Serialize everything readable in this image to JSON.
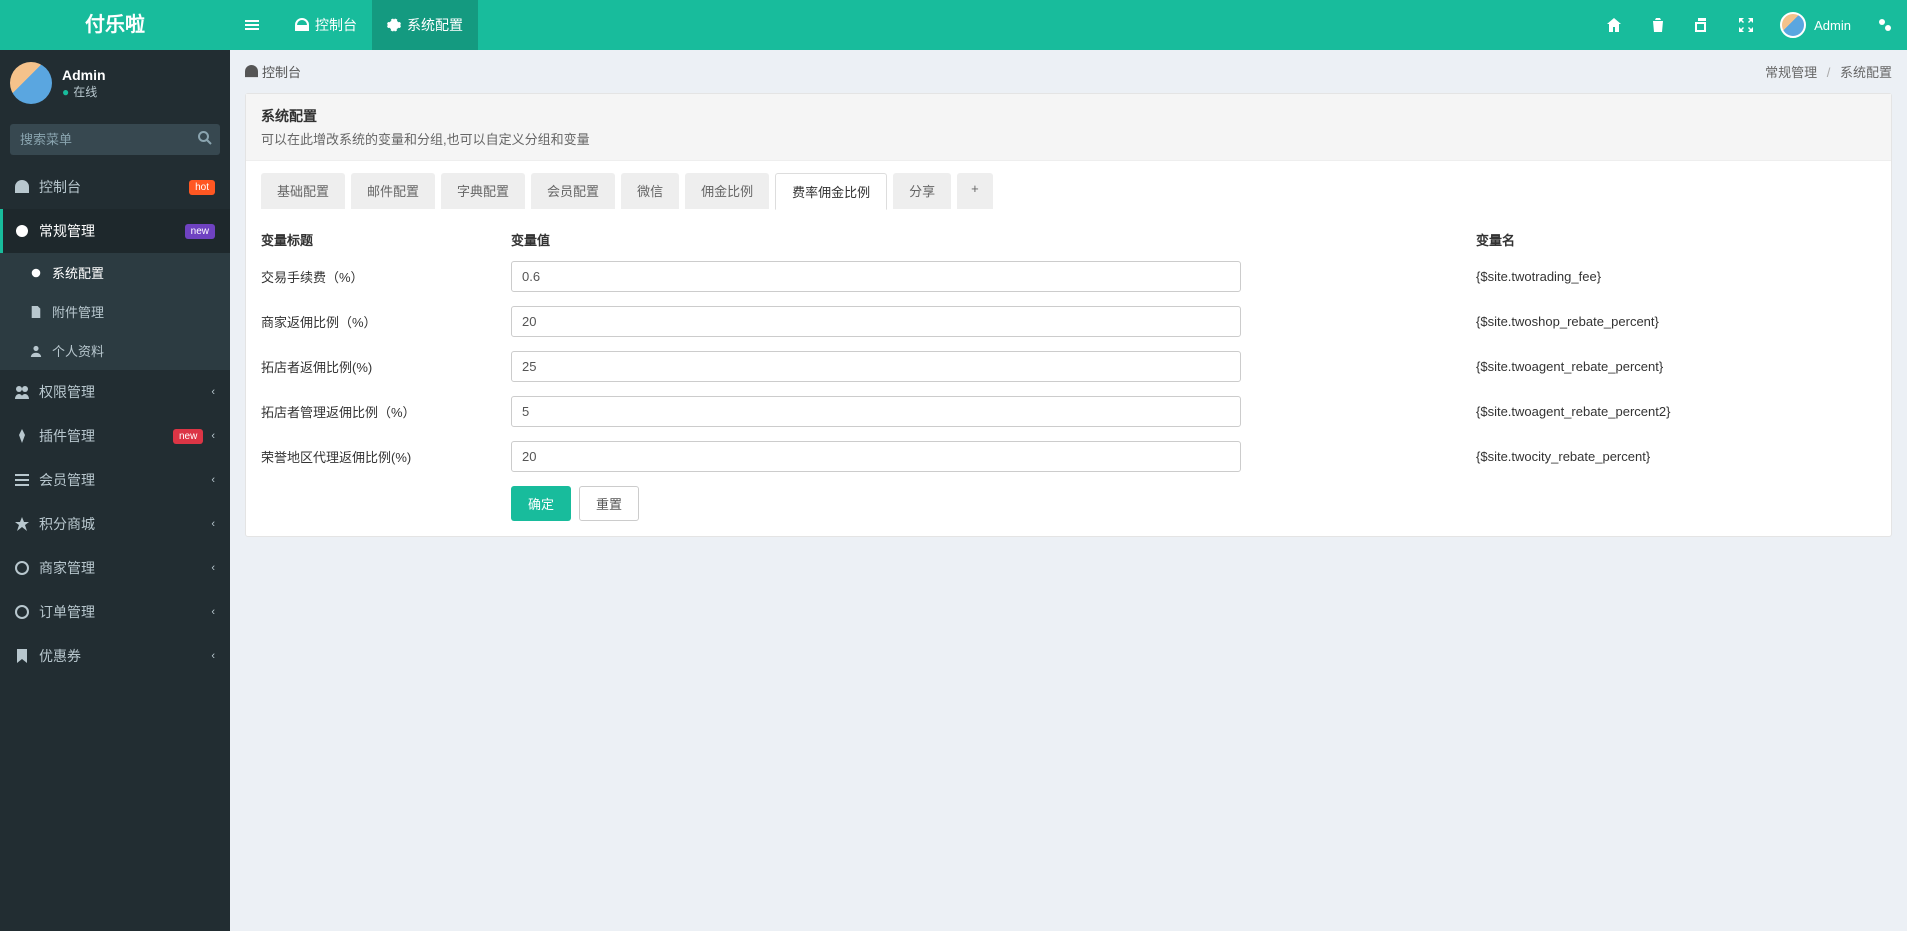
{
  "logo": "付乐啦",
  "topnav": {
    "toggle": "≡",
    "console": "控制台",
    "sysconfig": "系统配置",
    "user": "Admin"
  },
  "user_panel": {
    "name": "Admin",
    "status": "在线"
  },
  "search_placeholder": "搜索菜单",
  "menu": {
    "console": "控制台",
    "general": "常规管理",
    "sysconfig": "系统配置",
    "attach": "附件管理",
    "profile": "个人资料",
    "auth": "权限管理",
    "plugin": "插件管理",
    "member": "会员管理",
    "mall": "积分商城",
    "shop": "商家管理",
    "order": "订单管理",
    "coupon": "优惠券",
    "badge_hot": "hot",
    "badge_new": "new",
    "badge_new2": "new"
  },
  "crumb": {
    "home": "控制台",
    "path1": "常规管理",
    "path2": "系统配置"
  },
  "box": {
    "title": "系统配置",
    "desc": "可以在此增改系统的变量和分组,也可以自定义分组和变量"
  },
  "tabs": [
    "基础配置",
    "邮件配置",
    "字典配置",
    "会员配置",
    "微信",
    "佣金比例",
    "费率佣金比例",
    "分享"
  ],
  "active_tab": 6,
  "thead": {
    "label": "变量标题",
    "value": "变量值",
    "name": "变量名"
  },
  "rows": [
    {
      "label": "交易手续费（%）",
      "value": "0.6",
      "name": "{$site.twotrading_fee}"
    },
    {
      "label": "商家返佣比例（%）",
      "value": "20",
      "name": "{$site.twoshop_rebate_percent}"
    },
    {
      "label": "拓店者返佣比例(%)",
      "value": "25",
      "name": "{$site.twoagent_rebate_percent}"
    },
    {
      "label": "拓店者管理返佣比例（%）",
      "value": "5",
      "name": "{$site.twoagent_rebate_percent2}"
    },
    {
      "label": "荣誉地区代理返佣比例(%)",
      "value": "20",
      "name": "{$site.twocity_rebate_percent}"
    }
  ],
  "buttons": {
    "ok": "确定",
    "reset": "重置"
  }
}
